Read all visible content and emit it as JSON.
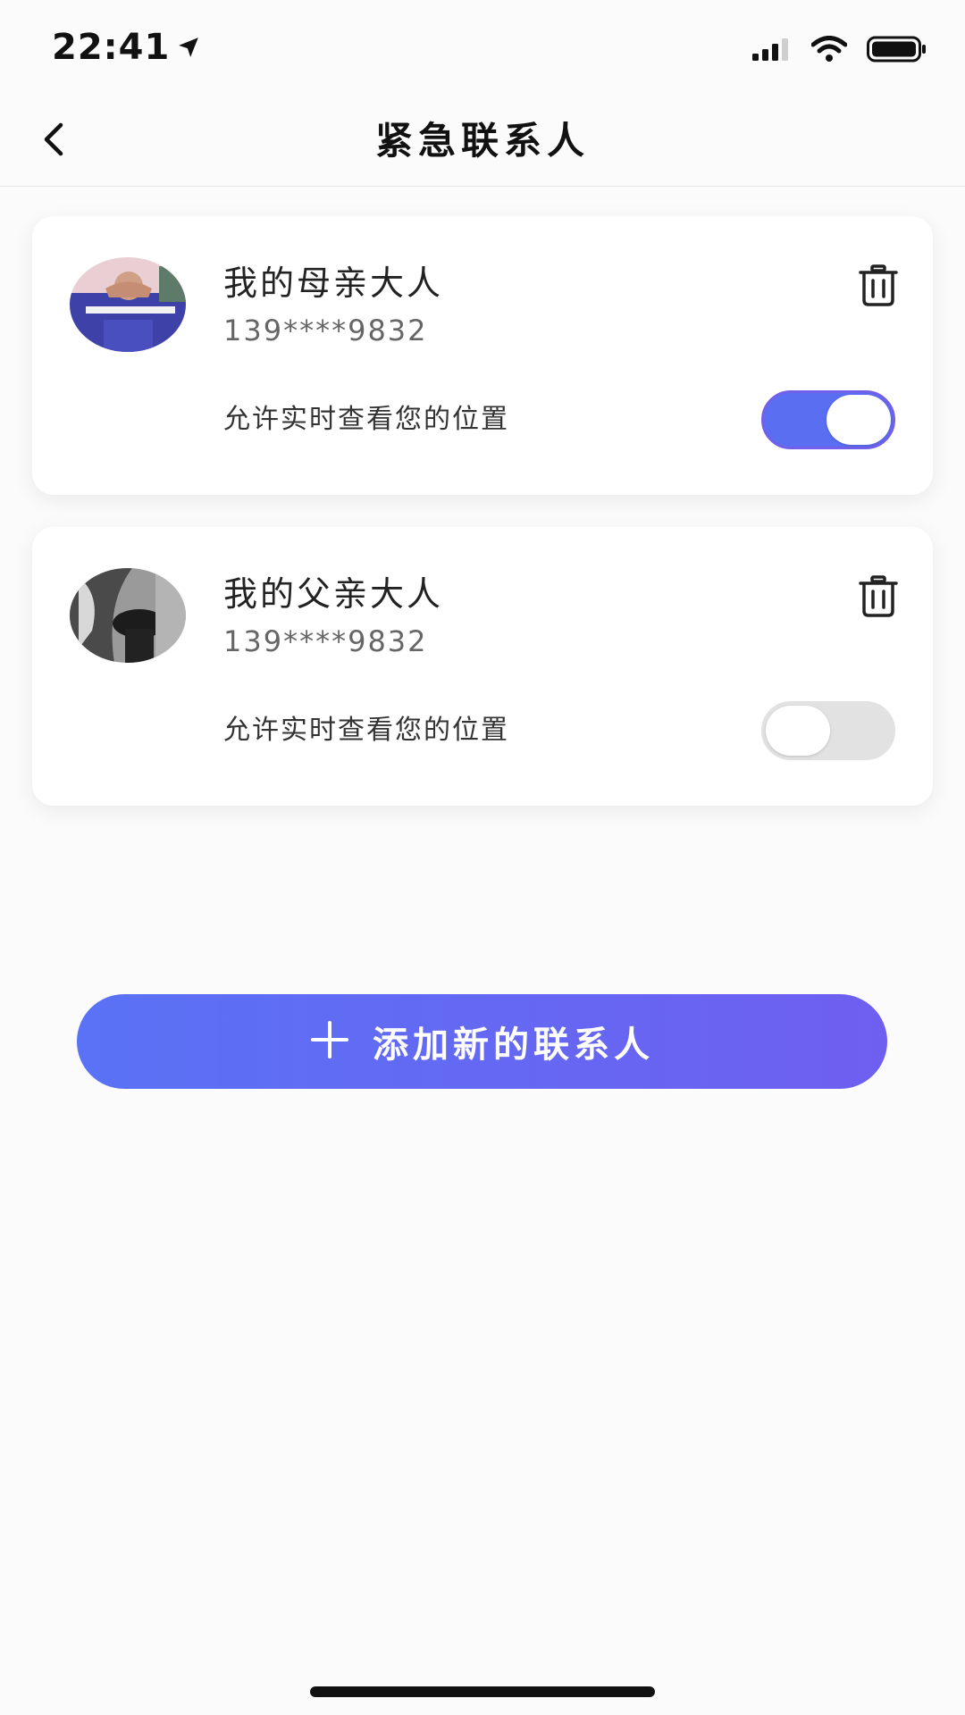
{
  "status_bar": {
    "time": "22:41",
    "icons": [
      "location-arrow-icon",
      "cellular-signal-icon",
      "wifi-icon",
      "battery-icon"
    ]
  },
  "nav": {
    "title": "紧急联系人",
    "back_icon": "chevron-left-icon"
  },
  "contacts": [
    {
      "name": "我的母亲大人",
      "phone": "139****9832",
      "permission_label": "允许实时查看您的位置",
      "location_sharing": true,
      "delete_icon": "trash-icon"
    },
    {
      "name": "我的父亲大人",
      "phone": "139****9832",
      "permission_label": "允许实时查看您的位置",
      "location_sharing": false,
      "delete_icon": "trash-icon"
    }
  ],
  "add_button": {
    "label": "添加新的联系人",
    "icon": "plus-icon"
  },
  "colors": {
    "accent_start": "#5a72f5",
    "accent_end": "#6e5ff0",
    "toggle_on": "#5a6ef2",
    "toggle_off": "#e2e2e2"
  }
}
